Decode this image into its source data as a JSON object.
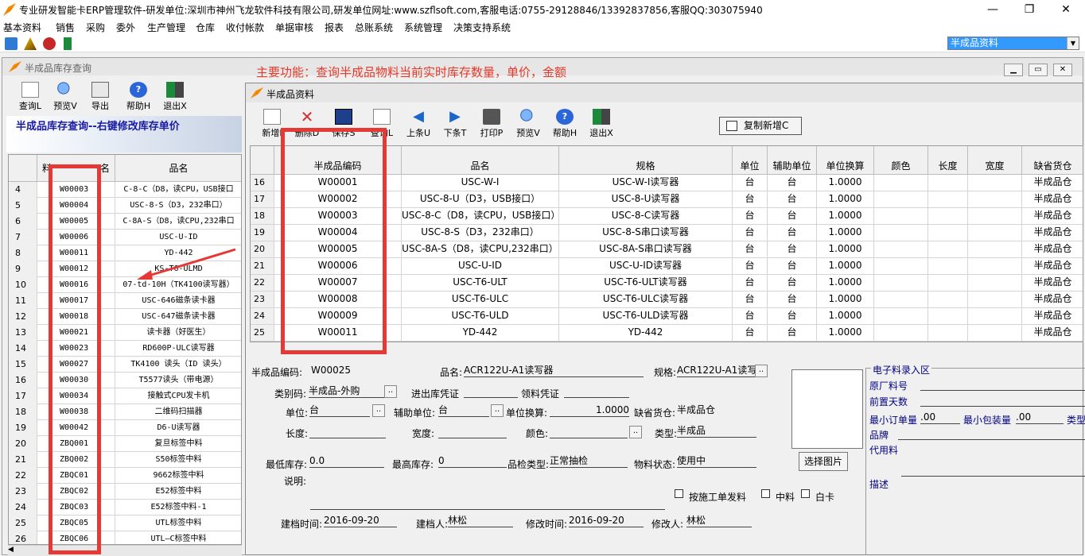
{
  "app_title": "专业研发智能卡ERP管理软件-研发单位:深圳市神州飞龙软件科技有限公司,研发单位网址:www.szflsoft.com,客服电话:0755-29128846/13392837856,客服QQ:303075940",
  "window_controls": {
    "minimize": "—",
    "maximize": "❐",
    "close": "✕"
  },
  "menu": [
    "基本资料",
    "销售",
    "采购",
    "委外",
    "生产管理",
    "仓库",
    "收付帐款",
    "单据审核",
    "报表",
    "总账系统",
    "系统管理",
    "决策支持系统"
  ],
  "module_combo": "半成品资料",
  "left_window": {
    "title": "半成品库存查询",
    "main_function": "主要功能：查询半成品物料当前实时库存数量，单价，金额",
    "toolbar": [
      "查询L",
      "预览V",
      "导出",
      "帮助H",
      "退出X"
    ],
    "banner": "半成品库存查询--右键修改库存单价",
    "columns": [
      "料",
      "名",
      "品名"
    ],
    "rows": [
      {
        "n": "4",
        "code": "W00003",
        "name": "C-8-C（D8，读CPU，USB接口"
      },
      {
        "n": "5",
        "code": "W00004",
        "name": "USC-8-S（D3，232串口）"
      },
      {
        "n": "6",
        "code": "W00005",
        "name": "C-8A-S（D8，读CPU,232串口"
      },
      {
        "n": "7",
        "code": "W00006",
        "name": "USC-U-ID"
      },
      {
        "n": "8",
        "code": "W00011",
        "name": "YD-442"
      },
      {
        "n": "9",
        "code": "W00012",
        "name": "KS-T6-ULMD"
      },
      {
        "n": "10",
        "code": "W00016",
        "name": "07-td-10H（TK4100读写器）"
      },
      {
        "n": "11",
        "code": "W00017",
        "name": "USC-646磁条读卡器"
      },
      {
        "n": "12",
        "code": "W00018",
        "name": "USC-647磁条读卡器"
      },
      {
        "n": "13",
        "code": "W00021",
        "name": "读卡器（好医生）"
      },
      {
        "n": "14",
        "code": "W00023",
        "name": "RD600P-ULC读写器"
      },
      {
        "n": "15",
        "code": "W00027",
        "name": "TK4100 读头（ID 读头）"
      },
      {
        "n": "16",
        "code": "W00030",
        "name": "T5577读头（带电源）"
      },
      {
        "n": "17",
        "code": "W00034",
        "name": "接触式CPU发卡机"
      },
      {
        "n": "18",
        "code": "W00038",
        "name": "二维码扫描器"
      },
      {
        "n": "19",
        "code": "W00042",
        "name": "D6-U读写器"
      },
      {
        "n": "20",
        "code": "ZBQ001",
        "name": "复旦标签中料"
      },
      {
        "n": "21",
        "code": "ZBQ002",
        "name": "S50标签中料"
      },
      {
        "n": "22",
        "code": "ZBQC01",
        "name": "9662标签中料"
      },
      {
        "n": "23",
        "code": "ZBQC02",
        "name": "E52标签中料"
      },
      {
        "n": "24",
        "code": "ZBQC03",
        "name": "E52标签中料-1"
      },
      {
        "n": "25",
        "code": "ZBQC05",
        "name": "UTL标签中料"
      },
      {
        "n": "26",
        "code": "ZBQC06",
        "name": "UTL—C标签中料"
      }
    ]
  },
  "right_window": {
    "title": "半成品资料",
    "toolbar": [
      "新增I",
      "删除D",
      "保存S",
      "查询L",
      "上条U",
      "下条T",
      "打印P",
      "预览V",
      "帮助H",
      "退出X"
    ],
    "copy_button": "复制新增C",
    "columns": [
      "半成品编码",
      "品名",
      "规格",
      "单位",
      "辅助单位",
      "单位换算",
      "颜色",
      "长度",
      "宽度",
      "缺省货仓"
    ],
    "rows": [
      {
        "n": "16",
        "code": "W00001",
        "name": "USC-W-I",
        "spec": "USC-W-I读写器",
        "unit": "台",
        "aux": "台",
        "conv": "1.0000",
        "wh": "半成品仓"
      },
      {
        "n": "17",
        "code": "W00002",
        "name": "USC-8-U（D3，USB接口）",
        "spec": "USC-8-U读写器",
        "unit": "台",
        "aux": "台",
        "conv": "1.0000",
        "wh": "半成品仓"
      },
      {
        "n": "18",
        "code": "W00003",
        "name": "USC-8-C（D8，读CPU，USB接口）",
        "spec": "USC-8-C读写器",
        "unit": "台",
        "aux": "台",
        "conv": "1.0000",
        "wh": "半成品仓"
      },
      {
        "n": "19",
        "code": "W00004",
        "name": "USC-8-S（D3，232串口）",
        "spec": "USC-8-S串口读写器",
        "unit": "台",
        "aux": "台",
        "conv": "1.0000",
        "wh": "半成品仓"
      },
      {
        "n": "20",
        "code": "W00005",
        "name": "USC-8A-S（D8，读CPU,232串口）",
        "spec": "USC-8A-S串口读写器",
        "unit": "台",
        "aux": "台",
        "conv": "1.0000",
        "wh": "半成品仓"
      },
      {
        "n": "21",
        "code": "W00006",
        "name": "USC-U-ID",
        "spec": "USC-U-ID读写器",
        "unit": "台",
        "aux": "台",
        "conv": "1.0000",
        "wh": "半成品仓"
      },
      {
        "n": "22",
        "code": "W00007",
        "name": "USC-T6-ULT",
        "spec": "USC-T6-ULT读写器",
        "unit": "台",
        "aux": "台",
        "conv": "1.0000",
        "wh": "半成品仓"
      },
      {
        "n": "23",
        "code": "W00008",
        "name": "USC-T6-ULC",
        "spec": "USC-T6-ULC读写器",
        "unit": "台",
        "aux": "台",
        "conv": "1.0000",
        "wh": "半成品仓"
      },
      {
        "n": "24",
        "code": "W00009",
        "name": "USC-T6-ULD",
        "spec": "USC-T6-ULD读写器",
        "unit": "台",
        "aux": "台",
        "conv": "1.0000",
        "wh": "半成品仓"
      },
      {
        "n": "25",
        "code": "W00011",
        "name": "YD-442",
        "spec": "YD-442",
        "unit": "台",
        "aux": "台",
        "conv": "1.0000",
        "wh": "半成品仓"
      }
    ],
    "form": {
      "code_label": "半成品编码:",
      "code": "W00025",
      "name_label": "品名:",
      "name": "ACR122U-A1读写器",
      "spec_label": "规格:",
      "spec": "ACR122U-A1读写",
      "cat_label": "类别码:",
      "cat": "半成品-外购",
      "io_label": "进出库凭证",
      "pick_label": "领料凭证",
      "unit_label": "单位:",
      "unit": "台",
      "aux_label": "辅助单位:",
      "aux": "台",
      "conv_label": "单位换算:",
      "conv": "1.0000",
      "wh_label": "缺省货仓:",
      "wh": "半成品仓",
      "len_label": "长度:",
      "width_label": "宽度:",
      "color_label": "颜色:",
      "type_label": "类型:",
      "type": "半成品",
      "min_label": "最低库存:",
      "min": "0.0",
      "max_label": "最高库存:",
      "max": "0",
      "qc_label": "品检类型:",
      "qc": "正常抽检",
      "status_label": "物料状态:",
      "status": "使用中",
      "desc_label": "说明:",
      "pic_button": "选择图片",
      "chk1": "按施工单发料",
      "chk2": "中料",
      "chk3": "白卡",
      "created_label": "建档时间:",
      "created": "2016-09-20",
      "creator_label": "建档人:",
      "creator": "林松",
      "modified_label": "修改时间:",
      "modified": "2016-09-20",
      "modifier_label": "修改人:",
      "modifier": "林松"
    },
    "elec": {
      "title": "电子料录入区",
      "orig_label": "原厂料号",
      "lead_label": "前置天数",
      "moq_label": "最小订单量",
      "moq": ".00",
      "mpq_label": "最小包装量",
      "mpq": ".00",
      "type_label": "类型",
      "brand_label": "品牌",
      "agent_label": "代用料",
      "desc_label": "描述"
    }
  }
}
